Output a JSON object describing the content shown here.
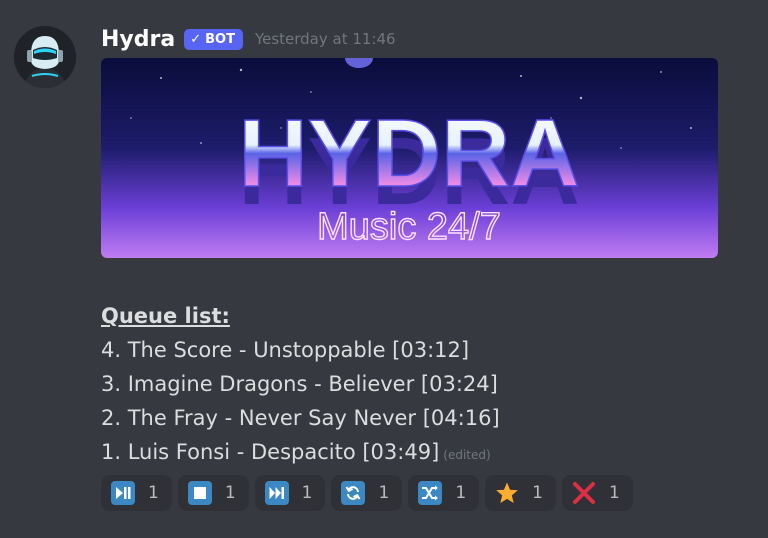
{
  "message": {
    "username": "Hydra",
    "bot_tag": "BOT",
    "bot_check": "✓",
    "timestamp": "Yesterday at 11:46",
    "queue_title": "Queue list:",
    "queue": [
      "4. The Score - Unstoppable [03:12]",
      "3. Imagine Dragons - Believer [03:24]",
      "2. The Fray - Never Say Never [04:16]",
      "1. Luis Fonsi - Despacito [03:49]"
    ],
    "edited_label": "(edited)"
  },
  "banner": {
    "title": "HYDRA",
    "subtitle": "Music 24/7"
  },
  "reactions": [
    {
      "icon": "play-pause-icon",
      "count": "1"
    },
    {
      "icon": "stop-icon",
      "count": "1"
    },
    {
      "icon": "next-track-icon",
      "count": "1"
    },
    {
      "icon": "repeat-icon",
      "count": "1"
    },
    {
      "icon": "shuffle-icon",
      "count": "1"
    },
    {
      "icon": "star-icon",
      "count": "1"
    },
    {
      "icon": "cross-icon",
      "count": "1"
    }
  ],
  "colors": {
    "background": "#36393f",
    "reaction_bg": "#2f3136",
    "bot_tag": "#5865f2",
    "button_icon": "#3b88c3",
    "star": "#ffac33",
    "cross": "#dd2e44"
  }
}
